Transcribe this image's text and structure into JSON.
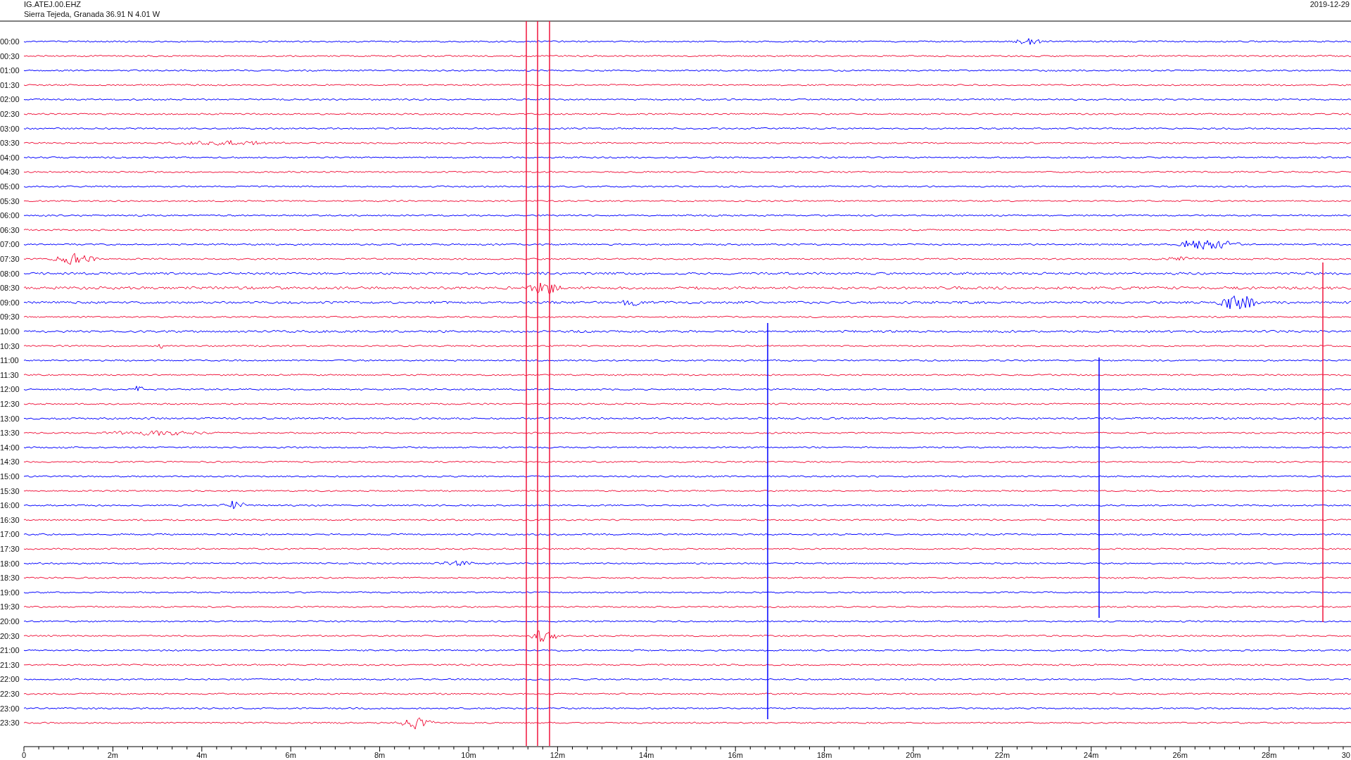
{
  "header": {
    "station": "IG.ATEJ.00.EHZ",
    "location": "Sierra Tejeda, Granada  36.91 N 4.01 W",
    "date": "2019-12-29"
  },
  "rows": [
    {
      "label": "00:00",
      "color": "#0000ff"
    },
    {
      "label": "00:30",
      "color": "#f0143c"
    },
    {
      "label": "01:00",
      "color": "#0000ff"
    },
    {
      "label": "01:30",
      "color": "#f0143c"
    },
    {
      "label": "02:00",
      "color": "#0000ff"
    },
    {
      "label": "02:30",
      "color": "#f0143c"
    },
    {
      "label": "03:00",
      "color": "#0000ff"
    },
    {
      "label": "03:30",
      "color": "#f0143c"
    },
    {
      "label": "04:00",
      "color": "#0000ff"
    },
    {
      "label": "04:30",
      "color": "#f0143c"
    },
    {
      "label": "05:00",
      "color": "#0000ff"
    },
    {
      "label": "05:30",
      "color": "#f0143c"
    },
    {
      "label": "06:00",
      "color": "#0000ff"
    },
    {
      "label": "06:30",
      "color": "#f0143c"
    },
    {
      "label": "07:00",
      "color": "#0000ff"
    },
    {
      "label": "07:30",
      "color": "#f0143c"
    },
    {
      "label": "08:00",
      "color": "#0000ff"
    },
    {
      "label": "08:30",
      "color": "#f0143c"
    },
    {
      "label": "09:00",
      "color": "#0000ff"
    },
    {
      "label": "09:30",
      "color": "#f0143c"
    },
    {
      "label": "10:00",
      "color": "#0000ff"
    },
    {
      "label": "10:30",
      "color": "#f0143c"
    },
    {
      "label": "11:00",
      "color": "#0000ff"
    },
    {
      "label": "11:30",
      "color": "#f0143c"
    },
    {
      "label": "12:00",
      "color": "#0000ff"
    },
    {
      "label": "12:30",
      "color": "#f0143c"
    },
    {
      "label": "13:00",
      "color": "#0000ff"
    },
    {
      "label": "13:30",
      "color": "#f0143c"
    },
    {
      "label": "14:00",
      "color": "#0000ff"
    },
    {
      "label": "14:30",
      "color": "#f0143c"
    },
    {
      "label": "15:00",
      "color": "#0000ff"
    },
    {
      "label": "15:30",
      "color": "#f0143c"
    },
    {
      "label": "16:00",
      "color": "#0000ff"
    },
    {
      "label": "16:30",
      "color": "#f0143c"
    },
    {
      "label": "17:00",
      "color": "#0000ff"
    },
    {
      "label": "17:30",
      "color": "#f0143c"
    },
    {
      "label": "18:00",
      "color": "#0000ff"
    },
    {
      "label": "18:30",
      "color": "#f0143c"
    },
    {
      "label": "19:00",
      "color": "#0000ff"
    },
    {
      "label": "19:30",
      "color": "#f0143c"
    },
    {
      "label": "20:00",
      "color": "#0000ff"
    },
    {
      "label": "20:30",
      "color": "#f0143c"
    },
    {
      "label": "21:00",
      "color": "#0000ff"
    },
    {
      "label": "21:30",
      "color": "#f0143c"
    },
    {
      "label": "22:00",
      "color": "#0000ff"
    },
    {
      "label": "22:30",
      "color": "#f0143c"
    },
    {
      "label": "23:00",
      "color": "#0000ff"
    },
    {
      "label": "23:30",
      "color": "#f0143c"
    }
  ],
  "x_axis": {
    "labels": [
      "0",
      "2m",
      "4m",
      "6m",
      "8m",
      "10m",
      "12m",
      "14m",
      "16m",
      "18m",
      "20m",
      "22m",
      "24m",
      "26m",
      "28m",
      "30"
    ]
  }
}
